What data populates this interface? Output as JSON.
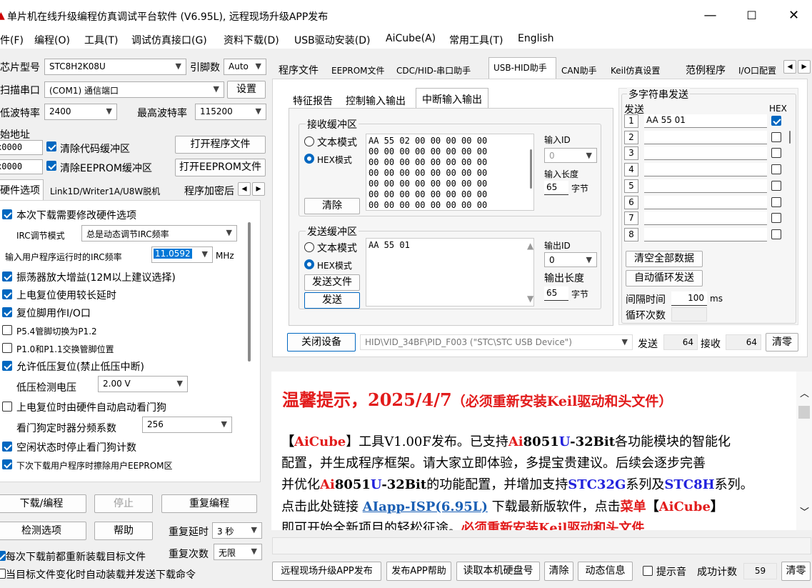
{
  "window": {
    "title": "单片机在线升级编程仿真调试平台软件 (V6.95L), 远程现场升级APP发布",
    "min": "—",
    "max": "☐",
    "close": "✕"
  },
  "menu": [
    "件(F)",
    "编程(O)",
    "工具(T)",
    "调试仿真接口(G)",
    "资料下载(D)",
    "USB驱动安装(D)",
    "AiCube(A)",
    "常用工具(T)",
    "English"
  ],
  "left": {
    "chip_label": "芯片型号",
    "chip_value": "STC8H2K08U",
    "pins_label": "引脚数",
    "pins_value": "Auto",
    "scan_label": "扫描串口",
    "port_value": "(COM1) 通信端口",
    "settings_btn": "设置",
    "minbaud_label": "低波特率",
    "minbaud_value": "2400",
    "maxbaud_label": "最高波特率",
    "maxbaud_value": "115200",
    "start_label": "始地址",
    "addr1": "x0000",
    "clear_code": "清除代码缓冲区",
    "open_prog": "打开程序文件",
    "addr2": "x0000",
    "clear_eeprom": "清除EEPROM缓冲区",
    "open_eeprom": "打开EEPROM文件",
    "tabs": [
      "硬件选项",
      "Link1D/Writer1A/U8W脱机",
      "程序加密后"
    ],
    "options": {
      "opt1": "本次下载需要修改硬件选项",
      "irc_mode_label": "IRC调节模式",
      "irc_mode_value": "总是动态调节IRC频率",
      "irc_freq_label": "输入用户程序运行时的IRC频率",
      "irc_freq_value": "11.0592",
      "irc_unit": "MHz",
      "opt2": "振荡器放大增益(12M以上建议选择)",
      "opt3": "上电复位使用较长延时",
      "opt4": "复位脚用作I/O口",
      "opt5": "P5.4管脚切换为P1.2",
      "opt6": "P1.0和P1.1交换管脚位置",
      "opt7": "允许低压复位(禁止低压中断)",
      "lvd_label": "低压检测电压",
      "lvd_value": "2.00 V",
      "opt8": "上电复位时由硬件自动启动看门狗",
      "wdt_label": "看门狗定时器分频系数",
      "wdt_value": "256",
      "opt9": "空闲状态时停止看门狗计数",
      "opt10": "下次下载用户程序时擦除用户EEPROM区"
    },
    "download_btn": "下载/编程",
    "stop_btn": "停止",
    "reprog_btn": "重复编程",
    "detect_btn": "检测选项",
    "help_btn": "帮助",
    "delay_label": "重复延时",
    "delay_value": "3 秒",
    "count_label": "重复次数",
    "count_value": "无限",
    "reload_opt": "每次下载前都重新装载目标文件",
    "auto_opt": "当目标文件变化时自动装载并发送下载命令"
  },
  "right": {
    "top_tabs": [
      "程序文件",
      "EEPROM文件",
      "CDC/HID-串口助手",
      "USB-HID助手",
      "CAN助手",
      "Keil仿真设置",
      "范例程序",
      "I/O口配置"
    ],
    "sub_tabs": [
      "特征报告",
      "控制输入输出",
      "中断输入输出"
    ],
    "recv_group": "接收缓冲区",
    "text_mode": "文本模式",
    "hex_mode": "HEX模式",
    "clear_btn": "清除",
    "recv_data": "AA 55 02 00 00 00 00 00\n00 00 00 00 00 00 00 00\n00 00 00 00 00 00 00 00\n00 00 00 00 00 00 00 00\n00 00 00 00 00 00 00 00\n00 00 00 00 00 00 00 00\n00 00 00 00 00 00 00 00",
    "in_id_label": "输入ID",
    "in_id_value": "0",
    "in_len_label": "输入长度",
    "in_len_value": "65",
    "bytes": "字节",
    "send_group": "发送缓冲区",
    "send_data": "AA 55 01",
    "send_file_btn": "发送文件",
    "send_btn": "发送",
    "out_id_label": "输出ID",
    "out_id_value": "0",
    "out_len_label": "输出长度",
    "out_len_value": "65",
    "close_dev_btn": "关闭设备",
    "device": "HID\\VID_34BF\\PID_F003 (\"STC\\STC USB Device\")",
    "send_label": "发送",
    "send_count": "64",
    "recv_label": "接收",
    "recv_count": "64",
    "zero_btn": "清零",
    "multi": {
      "group": "多字符串发送",
      "send_label": "发送",
      "hex_label": "HEX",
      "rows": [
        {
          "n": "1",
          "v": "AA 55 01"
        },
        {
          "n": "2",
          "v": ""
        },
        {
          "n": "3",
          "v": ""
        },
        {
          "n": "4",
          "v": ""
        },
        {
          "n": "5",
          "v": ""
        },
        {
          "n": "6",
          "v": ""
        },
        {
          "n": "7",
          "v": ""
        },
        {
          "n": "8",
          "v": ""
        }
      ],
      "clear_all": "清空全部数据",
      "auto_loop": "自动循环发送",
      "interval_label": "间隔时间",
      "interval_value": "100",
      "ms": "ms",
      "loops_label": "循环次数"
    },
    "notice": {
      "title": "温馨提示，2025/4/7",
      "title_note": "（必须重新安装Keil驱动和头文件）",
      "l1a": "【",
      "l1b": "AiCube",
      "l1c": "】工具V1.00F发布。已支持",
      "l1d": "Ai",
      "l1e": "8051",
      "l1f": "U",
      "l1g": "-32Bit",
      "l1h": "各功能模块的智能化",
      "l2": "配置，并生成程序框架。请大家立即体验，多提宝贵建议。后续会逐步完善",
      "l3a": "并优化",
      "l3b": "Ai",
      "l3c": "8051",
      "l3d": "U",
      "l3e": "-32Bit",
      "l3f": "的功能配置，并增加支持",
      "l3g": "STC32G",
      "l3h": "系列及",
      "l3i": "STC8H",
      "l3j": "系列。",
      "l4a": "点击此处链接 ",
      "l4b": "AIapp-ISP(6.95L)",
      "l4c": " 下载最新版软件，点击",
      "l4d": "菜单",
      "l4e": "【",
      "l4f": "AiCube",
      "l4g": "】",
      "l5a": "即可开始全新项目的轻松征途。",
      "l5b": "必须重新安装Keil驱动和头文件"
    },
    "bottom": {
      "remote_btn": "远程现场升级APP发布",
      "app_help_btn": "发布APP帮助",
      "read_disk_btn": "读取本机硬盘号",
      "clear_btn": "清除",
      "dyn_btn": "动态信息",
      "beep": "提示音",
      "success_label": "成功计数",
      "success_value": "59",
      "zero_btn": "清零"
    }
  }
}
